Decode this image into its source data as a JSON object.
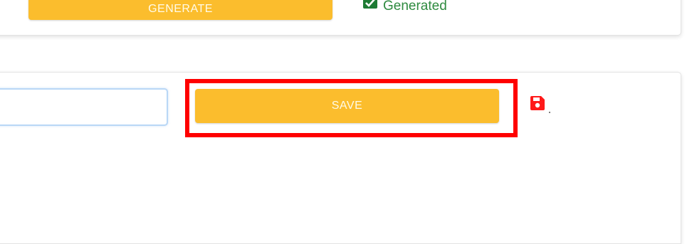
{
  "generate_section": {
    "button_label": "GENERATE",
    "status_text": "Generated",
    "status_icon": "check-square-icon",
    "status_color": "#2e8a3f"
  },
  "save_section": {
    "input_value": "",
    "button_label": "SAVE",
    "save_icon": "floppy-disk-icon",
    "save_icon_color": "#ff1a1a",
    "highlight_color": "#ff0000"
  },
  "colors": {
    "button_bg": "#fbbd2d",
    "button_text": "#fffbe9",
    "input_border": "#b9d7f6"
  }
}
